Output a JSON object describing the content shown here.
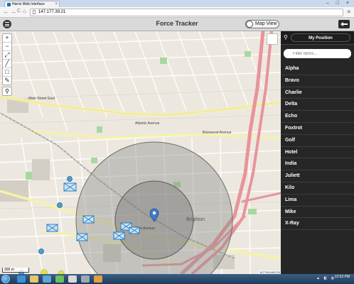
{
  "browser": {
    "tab_title": "Harris Web Interface",
    "url": "147.177.39.21",
    "nav_back": "←",
    "nav_forward": "→",
    "nav_reload": "C",
    "nav_home": "⌂",
    "menu": "≡",
    "window_controls": "– □ ×"
  },
  "app": {
    "title": "Force Tracker",
    "map_view_label": "Map View"
  },
  "map": {
    "zoom_in": "+",
    "zoom_out": "−",
    "scale_label": "300 m",
    "attribution": "1677000495725",
    "place_label": "Brighton",
    "street_labels": [
      "Main Street East",
      "Atlantic Avenue",
      "Brierwood Avenue",
      "East Avenue"
    ]
  },
  "sidebar": {
    "my_position_label": "My Position",
    "filter_placeholder": "Filter items...",
    "units": [
      "Alpha",
      "Bravo",
      "Charlie",
      "Delta",
      "Echo",
      "Foxtrot",
      "Golf",
      "Hotel",
      "India",
      "Juliett",
      "Kilo",
      "Lima",
      "Mike",
      "X-Ray"
    ]
  },
  "taskbar": {
    "time": "12:53 PM"
  },
  "colors": {
    "sidebar_bg": "#262626",
    "map_bg": "#ede8df",
    "highway": "#e8949a",
    "primary_road": "#f6f2a8",
    "range_circle": "#8d8d8d",
    "unit_marker": "#4aa0d6"
  }
}
